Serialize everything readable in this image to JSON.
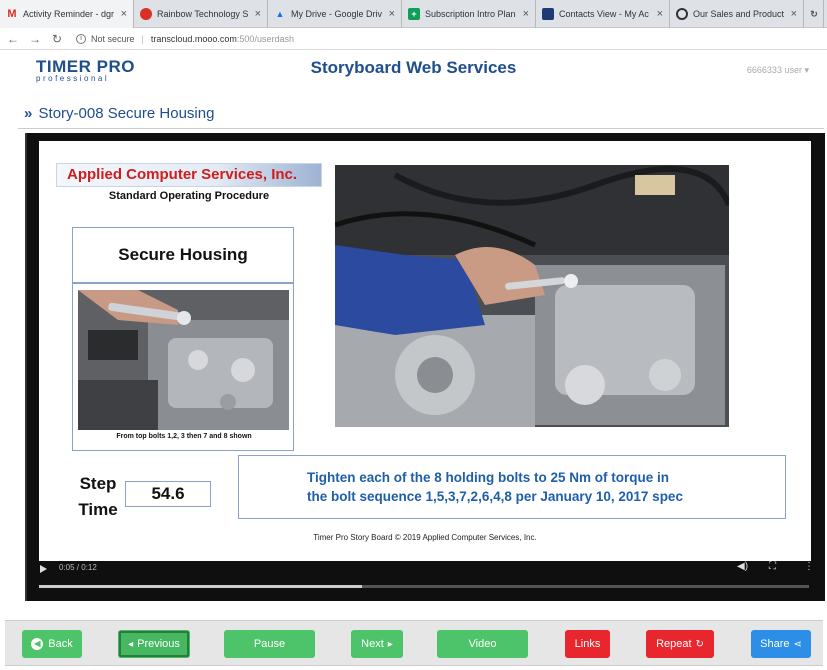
{
  "browser": {
    "tabs": [
      {
        "label": "Activity Reminder - dgr",
        "icon": "gmail-icon",
        "glyph": "M"
      },
      {
        "label": "Rainbow Technology S",
        "icon": "rainbow-icon",
        "glyph": "●"
      },
      {
        "label": "My Drive - Google Driv",
        "icon": "drive-icon",
        "glyph": "▲"
      },
      {
        "label": "Subscription Intro Plan",
        "icon": "sheets-icon",
        "glyph": "+"
      },
      {
        "label": "Contacts View - My Ac",
        "icon": "contacts-icon",
        "glyph": "▣"
      },
      {
        "label": "Our Sales and Product",
        "icon": "circle-icon",
        "glyph": "◑"
      }
    ],
    "security_label": "Not secure",
    "url_host": "transcloud.mooo.com",
    "url_path": ":500/userdash"
  },
  "header": {
    "logo_line1": "TIMER PRO",
    "logo_line2": "professional",
    "title": "Storyboard Web Services",
    "user": "6666333 user"
  },
  "breadcrumb": {
    "chevron": "»",
    "text": "Story-008 Secure Housing"
  },
  "slide": {
    "company": "Applied Computer Services, Inc.",
    "sop": "Standard Operating Procedure",
    "step_title": "Secure Housing",
    "photo_caption": "From top bolts 1,2, 3 then 7 and 8 shown",
    "step_label_1": "Step",
    "step_label_2": "Time",
    "step_time": "54.6",
    "instruction_line1": "Tighten each of the 8 holding bolts to 25 Nm of torque in",
    "instruction_line2": "the bolt sequence 1,5,3,7,2,6,4,8 per January 10, 2017 spec",
    "footer": "Timer Pro Story Board © 2019 Applied Computer Services, Inc."
  },
  "player": {
    "timecode": "0:05 / 0:12",
    "progress": 0.42
  },
  "buttons": {
    "back": "Back",
    "previous": "Previous",
    "pause": "Pause",
    "next": "Next",
    "video": "Video",
    "links": "Links",
    "repeat": "Repeat",
    "share": "Share"
  },
  "colors": {
    "brand_blue": "#1f4e8c",
    "button_green": "#4ec46a",
    "button_red": "#e8262d",
    "button_blue": "#2c8ee6",
    "company_red": "#d21c1c",
    "instruction_blue": "#1f5fa8"
  }
}
